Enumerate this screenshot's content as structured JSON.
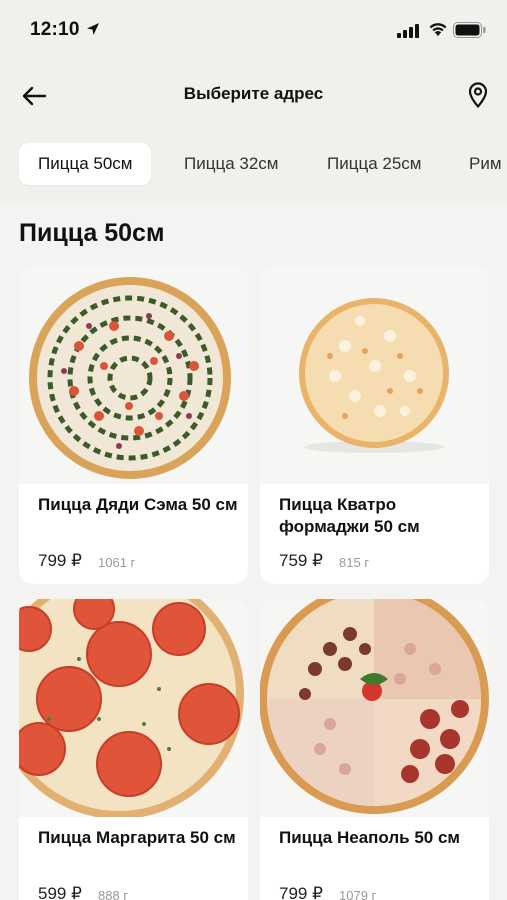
{
  "status_bar": {
    "time": "12:10"
  },
  "header": {
    "title": "Выберите адрес"
  },
  "tabs": [
    "Пицца 50см",
    "Пицца 32см",
    "Пицца 25см",
    "Рим"
  ],
  "section": {
    "title": "Пицца 50см"
  },
  "products": [
    {
      "name": "Пицца Дяди Сэма 50 см",
      "price": "799 ₽",
      "weight": "1061 г"
    },
    {
      "name": "Пицца Кватро формаджи 50 см",
      "price": "759 ₽",
      "weight": "815 г"
    },
    {
      "name": "Пицца Маргарита 50 см",
      "price": "599 ₽",
      "weight": "888 г"
    },
    {
      "name": "Пицца Неаполь 50 см",
      "price": "799 ₽",
      "weight": "1079 г"
    }
  ],
  "colors": {
    "background": "#f3f3f1",
    "active_tab": "#ffffff",
    "text": "#111111",
    "muted": "#9a9a9a"
  }
}
